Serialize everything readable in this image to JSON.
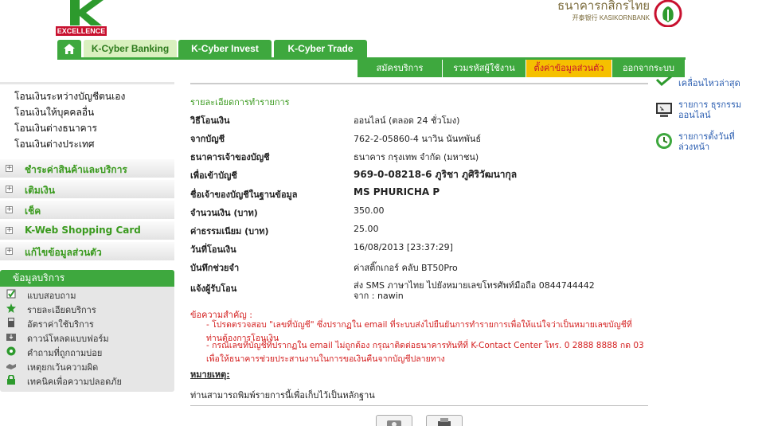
{
  "header": {
    "logo_text": "EXCELLENCE",
    "bank_name_th": "ธนาคารกสิกรไทย",
    "bank_name_en": "开泰银行 KASIKORNBANK"
  },
  "tabs": [
    "K-Cyber Banking",
    "K-Cyber Invest",
    "K-Cyber Trade"
  ],
  "subnav": [
    "สมัครบริการ",
    "รวมรหัสผู้ใช้งาน",
    "ตั้งค่าข้อมูลส่วนตัว",
    "ออกจากระบบ"
  ],
  "sidebar": {
    "links": [
      "โอนเงินระหว่างบัญชีตนเอง",
      "โอนเงินให้บุคคลอื่น",
      "โอนเงินต่างธนาคาร",
      "โอนเงินต่างประเทศ"
    ],
    "menus": [
      "ชำระค่าสินค้าและบริการ",
      "เติมเงิน",
      "เช็ค",
      "K-Web Shopping Card",
      "แก้ไขข้อมูลส่วนตัว"
    ],
    "services_title": "ข้อมูลบริการ",
    "services": [
      "แบบสอบถาม",
      "รายละเอียดบริการ",
      "อัตราค่าใช้บริการ",
      "ดาวน์โหลดแบบฟอร์ม",
      "คำถามที่ถูกถามบ่อย",
      "เหตุยกเว้นความผิด",
      "เทคนิคเพื่อความปลอดภัย"
    ]
  },
  "main": {
    "title": "รายละเอียดการทำรายการ",
    "rows": [
      {
        "label": "วิธีโอนเงิน",
        "value": "ออนไลน์ (ตลอด 24 ชั่วโมง)"
      },
      {
        "label": "จากบัญชี",
        "value": "762-2-05860-4 นาวิน นันทพันธ์"
      },
      {
        "label": "ธนาคารเจ้าของบัญชี",
        "value": "ธนาคาร กรุงเทพ จำกัด (มหาชน)"
      },
      {
        "label": "เพื่อเข้าบัญชี",
        "value": "969-0-08218-6 ภูริชา ภูศิริวัฒนากุล"
      },
      {
        "label": "ชื่อเจ้าของบัญชีในฐานข้อมูล",
        "value": "MS PHURICHA P"
      },
      {
        "label": "จำนวนเงิน (บาท)",
        "value": "350.00"
      },
      {
        "label": "ค่าธรรมเนียม (บาท)",
        "value": "25.00"
      },
      {
        "label": "วันที่โอนเงิน",
        "value": "16/08/2013 [23:37:29]"
      },
      {
        "label": "บันทึกช่วยจำ",
        "value": "ค่าสติ๊กเกอร์ คลับ BT50Pro"
      },
      {
        "label": "แจ้งผู้รับโอน",
        "value": "ส่ง SMS ภาษาไทย ไปยังหมายเลขโทรศัพท์มือถือ 0844744442"
      }
    ],
    "sms_from": "จาก : nawin",
    "warn_title": "ข้อความสำคัญ :",
    "warn_1": "- โปรดตรวจสอบ \"เลขที่บัญชี\" ซึ่งปรากฏใน email ที่ระบบส่งไปยืนยันการทำรายการเพื่อให้แน่ใจว่าเป็นหมายเลขบัญชีที่ท่านต้องการโอนเงิน",
    "warn_2": "- กรณีเลขที่บัญชีที่ปรากฏใน email ไม่ถูกต้อง กรุณาติดต่อธนาคารทันทีที่ K-Contact Center โทร. 0 2888 8888 กด 03 เพื่อให้ธนาคารช่วยประสานงานในการขอเงินคืนจากบัญชีปลายทาง",
    "remark_title": "หมายเหตุ:",
    "remark_text": "ท่านสามารถพิมพ์รายการนี้เพื่อเก็บไว้เป็นหลักฐาน"
  },
  "right": [
    {
      "text": "เคลื่อนไหวล่าสุด"
    },
    {
      "text": "รายการ ธุรกรรมออนไลน์"
    },
    {
      "text": "รายการตั้งวันที่ ล่วงหน้า"
    }
  ],
  "colors": {
    "brand_green": "#3ea83e",
    "highlight": "#f5c000",
    "warn_red": "#d42020"
  }
}
